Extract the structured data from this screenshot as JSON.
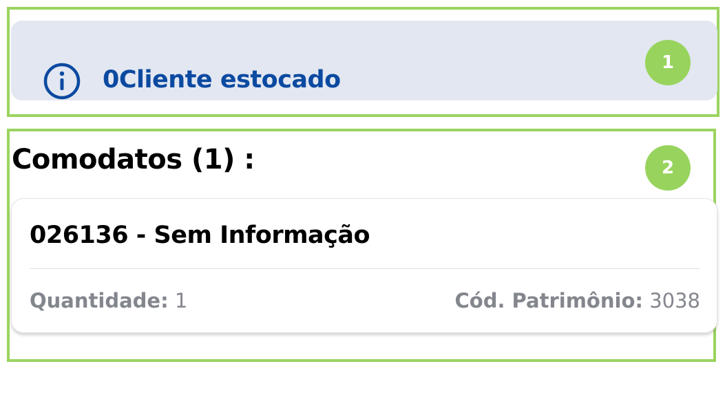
{
  "banner": {
    "icon": "info-icon",
    "text": "0Cliente estocado",
    "text_color": "#0c4aa1",
    "background": "#e2e7f1"
  },
  "annotations": {
    "badge_1": "1",
    "badge_2": "2",
    "color": "#98d45d"
  },
  "comodatos": {
    "title": "Comodatos (1) :",
    "items": [
      {
        "title": "026136 - Sem Informação",
        "quantidade_label": "Quantidade:",
        "quantidade_value": "1",
        "patrimonio_label": "Cód. Patrimônio:",
        "patrimonio_value": "3038"
      }
    ]
  }
}
